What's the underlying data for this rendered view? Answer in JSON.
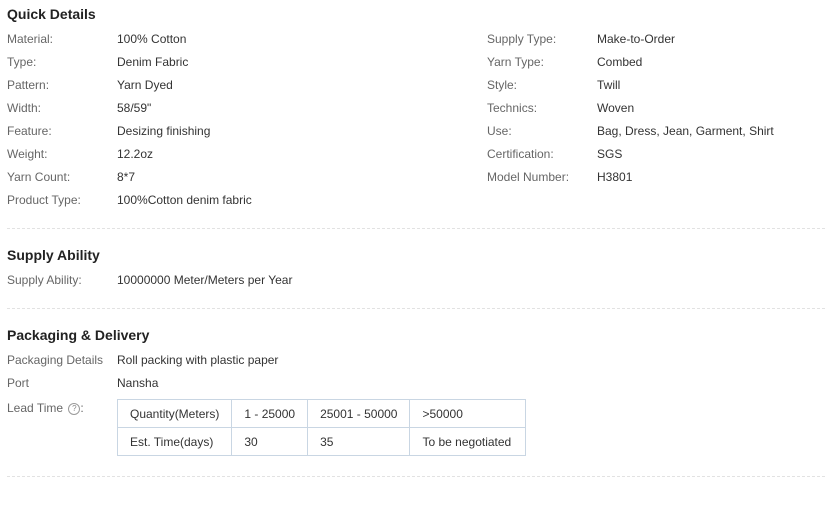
{
  "quick_details": {
    "title": "Quick Details",
    "left": [
      {
        "label": "Material:",
        "value": "100% Cotton"
      },
      {
        "label": "Type:",
        "value": "Denim Fabric"
      },
      {
        "label": "Pattern:",
        "value": "Yarn Dyed"
      },
      {
        "label": "Width:",
        "value": "58/59\""
      },
      {
        "label": "Feature:",
        "value": "Desizing finishing"
      },
      {
        "label": "Weight:",
        "value": "12.2oz"
      },
      {
        "label": "Yarn Count:",
        "value": "8*7"
      },
      {
        "label": "Product Type:",
        "value": "100%Cotton denim fabric"
      }
    ],
    "right": [
      {
        "label": "Supply Type:",
        "value": "Make-to-Order"
      },
      {
        "label": "Yarn Type:",
        "value": "Combed"
      },
      {
        "label": "Style:",
        "value": "Twill"
      },
      {
        "label": "Technics:",
        "value": "Woven"
      },
      {
        "label": "Use:",
        "value": "Bag, Dress, Jean, Garment, Shirt"
      },
      {
        "label": "Certification:",
        "value": "SGS"
      },
      {
        "label": "Model Number:",
        "value": "H3801"
      }
    ]
  },
  "supply_ability": {
    "title": "Supply Ability",
    "label": "Supply Ability:",
    "value": "10000000 Meter/Meters per Year"
  },
  "packaging": {
    "title": "Packaging & Delivery",
    "details_label": "Packaging Details",
    "details_value": "Roll packing with plastic paper",
    "port_label": "Port",
    "port_value": "Nansha",
    "lead_label": "Lead Time",
    "help_glyph": "?",
    "lead_table": {
      "rows": [
        [
          "Quantity(Meters)",
          "1 - 25000",
          "25001 - 50000",
          ">50000"
        ],
        [
          "Est. Time(days)",
          "30",
          "35",
          "To be negotiated"
        ]
      ]
    }
  }
}
